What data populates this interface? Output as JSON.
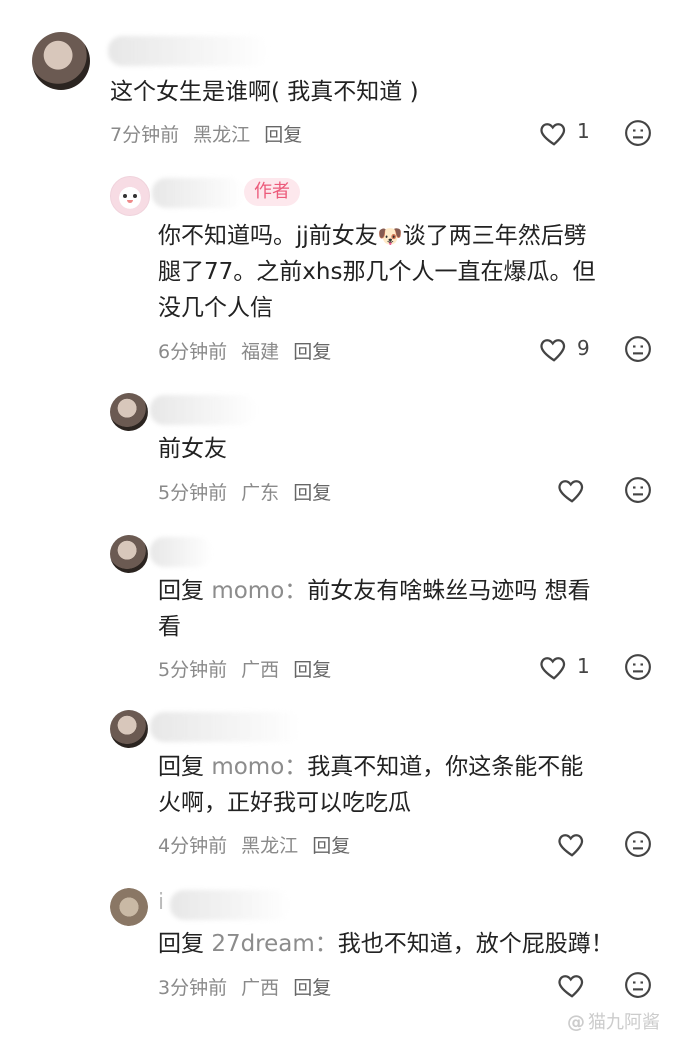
{
  "comments": [
    {
      "text": "这个女生是谁啊( 我真不知道 )",
      "time": "7分钟前",
      "location": "黑龙江",
      "reply_label": "回复",
      "likes": "1"
    },
    {
      "author_tag": "作者",
      "text_line1": "你不知道吗。jj前女友",
      "emoji": "🐶",
      "text_line1b": "谈了两三年然后劈",
      "text_line2": "腿了77。之前xhs那几个人一直在爆瓜。但",
      "text_line3": "没几个人信",
      "time": "6分钟前",
      "location": "福建",
      "reply_label": "回复",
      "likes": "9"
    },
    {
      "text": "前女友",
      "time": "5分钟前",
      "location": "广东",
      "reply_label": "回复",
      "likes": ""
    },
    {
      "reply_prefix": "回复",
      "reply_user": "momo：",
      "text_line1": "前女友有啥蛛丝马迹吗 想看",
      "text_line2": "看",
      "time": "5分钟前",
      "location": "广西",
      "reply_label": "回复",
      "likes": "1"
    },
    {
      "reply_prefix": "回复",
      "reply_user": "momo：",
      "text_line1": "我真不知道，你这条能不能",
      "text_line2": "火啊，正好我可以吃吃瓜",
      "time": "4分钟前",
      "location": "黑龙江",
      "reply_label": "回复",
      "likes": ""
    },
    {
      "partial_name": "i",
      "reply_prefix": "回复",
      "reply_user": "27dream：",
      "text": "我也不知道，放个屁股蹲！",
      "time": "3分钟前",
      "location": "广西",
      "reply_label": "回复",
      "likes": ""
    }
  ],
  "watermark": {
    "at": "@",
    "name": "猫九阿酱"
  },
  "colors": {
    "author_tag_bg": "#fde8ed",
    "author_tag_text": "#ec5b7b",
    "meta_text": "#8a8a8a",
    "reply_user": "#8c8c8c"
  }
}
